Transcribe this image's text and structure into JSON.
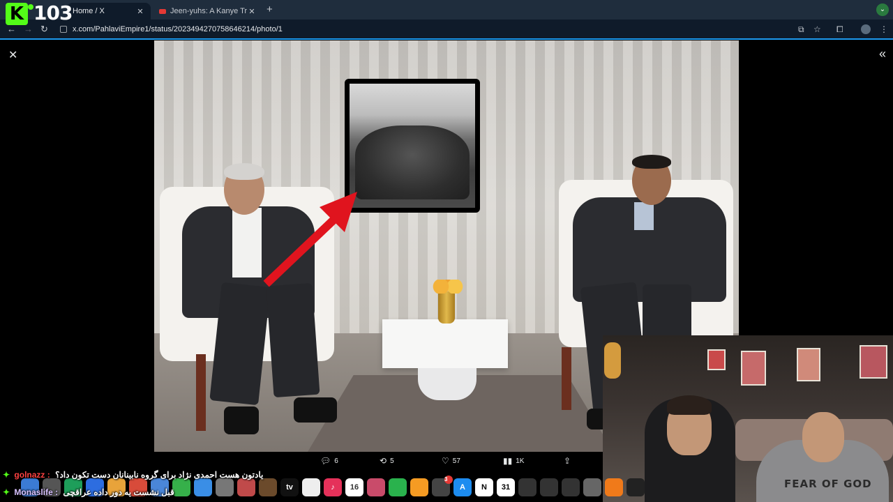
{
  "browser": {
    "tabs": [
      {
        "label": "Home / X",
        "active": true
      },
      {
        "label": "Jeen-yuhs: A Kanye Trilogy | ",
        "active": false
      }
    ],
    "url": "x.com/PahlaviEmpire1/status/2023494270758646214/photo/1"
  },
  "stream": {
    "viewer_count": "103",
    "logo_letter": "K"
  },
  "tweet": {
    "replies": "6",
    "reposts": "5",
    "likes": "57",
    "views": "1K"
  },
  "webcam": {
    "hoodie_text": "FEAR OF GOD"
  },
  "chat": [
    {
      "user": "golnazz :",
      "message": "یادتون هست احمدی نژاد برای گروه نابینانان دست تکون داد؟"
    },
    {
      "user": "Monaslife :",
      "message": "قبل نشست یه دور داده عراقچی"
    }
  ],
  "dock": {
    "calendar_day": "16",
    "calendar_day2": "31",
    "notification_count": "3",
    "tv_label": "tv"
  },
  "colors": {
    "accent": "#1d9bf0",
    "kick_green": "#53fc18",
    "arrow_red": "#e0141e"
  }
}
